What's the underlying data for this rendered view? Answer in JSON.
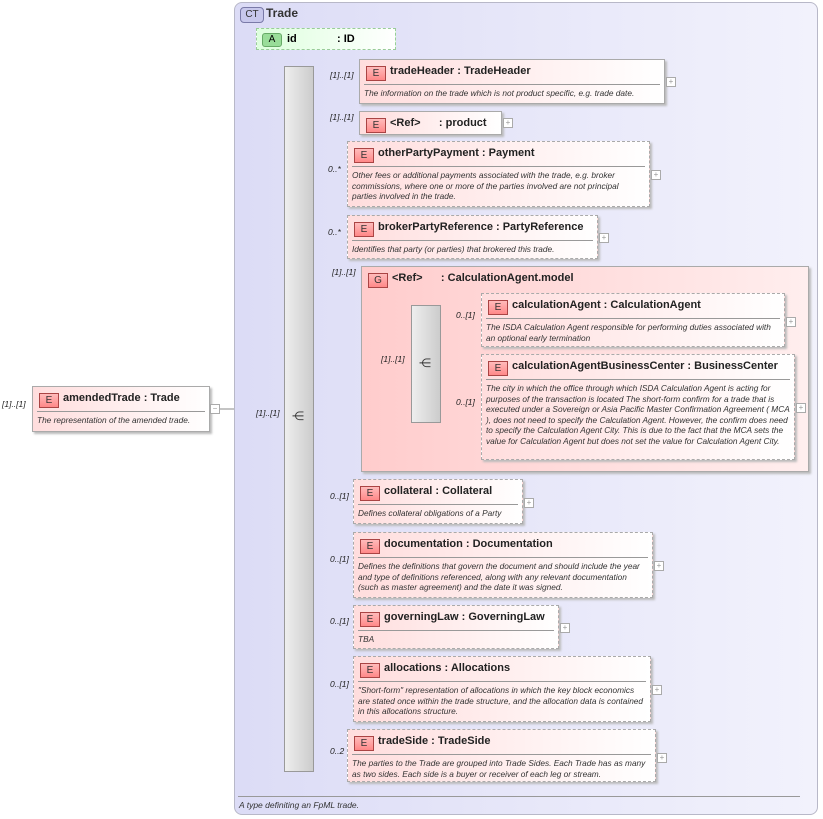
{
  "complex_type": {
    "badge": "CT",
    "title": "Trade",
    "footer": "A type definiting an FpML trade."
  },
  "root": {
    "badge": "E",
    "name": "amendedTrade : Trade",
    "desc": "The representation of the amended trade.",
    "card": "[1]..[1]"
  },
  "attribute": {
    "badge": "A",
    "name": "id",
    "type": ": ID"
  },
  "sequence": {
    "card": "[1]..[1]"
  },
  "elements": [
    {
      "badge": "E",
      "name": "tradeHeader : TradeHeader",
      "desc": "The information on the trade which is not product specific, e.g. trade date.",
      "card": "[1]..[1]"
    },
    {
      "badge": "E",
      "name": "<Ref>      : product",
      "desc": "",
      "card": "[1]..[1]"
    },
    {
      "badge": "E",
      "name": "otherPartyPayment : Payment",
      "desc": "Other fees or additional payments associated with the trade, e.g. broker commissions, where one or more of the parties involved are not principal parties involved in the trade.",
      "card": "0..*"
    },
    {
      "badge": "E",
      "name": "brokerPartyReference : PartyReference",
      "desc": "Identifies that party (or parties) that brokered this trade.",
      "card": "0..*"
    },
    {
      "badge": "E",
      "name": "collateral : Collateral",
      "desc": "Defines collateral obligations of a Party",
      "card": "0..[1]"
    },
    {
      "badge": "E",
      "name": "documentation : Documentation",
      "desc": "Defines the definitions that govern the document and should include the year and type of definitions referenced, along with any relevant documentation (such as master agreement) and the date it was signed.",
      "card": "0..[1]"
    },
    {
      "badge": "E",
      "name": "governingLaw : GoverningLaw",
      "desc": "TBA",
      "card": "0..[1]"
    },
    {
      "badge": "E",
      "name": "allocations : Allocations",
      "desc": "\"Short-form\" representation of allocations in which the key block economics are stated once within the trade structure, and the allocation data is contained in this allocations structure.",
      "card": "0..[1]"
    },
    {
      "badge": "E",
      "name": "tradeSide : TradeSide",
      "desc": "The parties to the Trade are grouped into Trade Sides. Each Trade has as many as two sides. Each side is a buyer or receiver of each leg or stream.",
      "card": "0..2"
    }
  ],
  "group": {
    "badge": "G",
    "name": "<Ref>      : CalculationAgent.model",
    "card": "[1]..[1]",
    "seq_card": "[1]..[1]",
    "elements": [
      {
        "badge": "E",
        "name": "calculationAgent : CalculationAgent",
        "desc": "The ISDA Calculation Agent responsible for performing duties associated with an optional early termination",
        "card": "0..[1]"
      },
      {
        "badge": "E",
        "name": "calculationAgentBusinessCenter : BusinessCenter",
        "desc": "The city in which the office through which ISDA Calculation Agent is acting for purposes of the transaction is located The short-form confirm for a trade that is executed under a Sovereign or Asia Pacific Master Confirmation Agreement ( MCA ), does not need to specify the Calculation Agent. However, the confirm does need to specify the Calculation Agent City. This is due to the fact that the MCA sets the value for Calculation Agent but does not set the value for Calculation Agent City.",
        "card": "0..[1]"
      }
    ]
  },
  "expand_symbol": "+",
  "collapse_symbol": "−",
  "seq_symbol": "⋲"
}
